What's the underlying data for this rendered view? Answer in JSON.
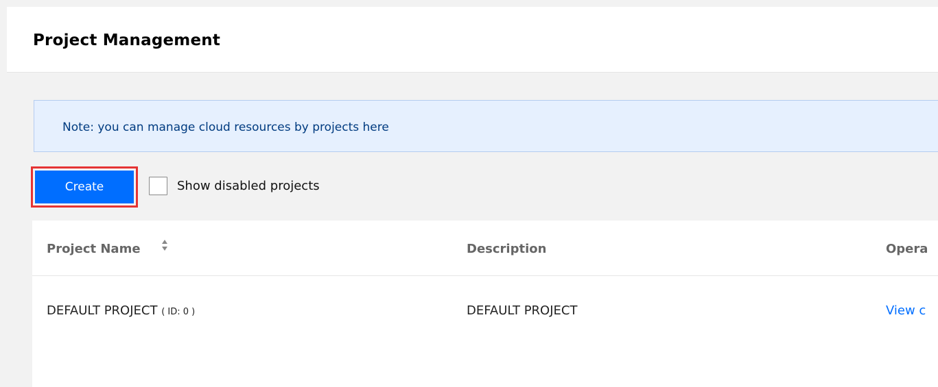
{
  "header": {
    "title": "Project Management"
  },
  "notice": {
    "text": "Note: you can manage cloud resources by projects here"
  },
  "toolbar": {
    "create_label": "Create",
    "show_disabled_label": "Show disabled projects",
    "show_disabled_checked": false
  },
  "table": {
    "columns": [
      {
        "label": "Project Name",
        "sortable": true
      },
      {
        "label": "Description"
      },
      {
        "label": "Opera"
      }
    ],
    "rows": [
      {
        "name": "DEFAULT PROJECT",
        "id_text": "( ID: 0 )",
        "description": "DEFAULT PROJECT",
        "operation": "View c"
      }
    ]
  },
  "colors": {
    "accent": "#006eff",
    "highlight_border": "#e53333",
    "notice_bg": "#e6f0fe"
  },
  "icons": {
    "sort": "sort-icon"
  }
}
